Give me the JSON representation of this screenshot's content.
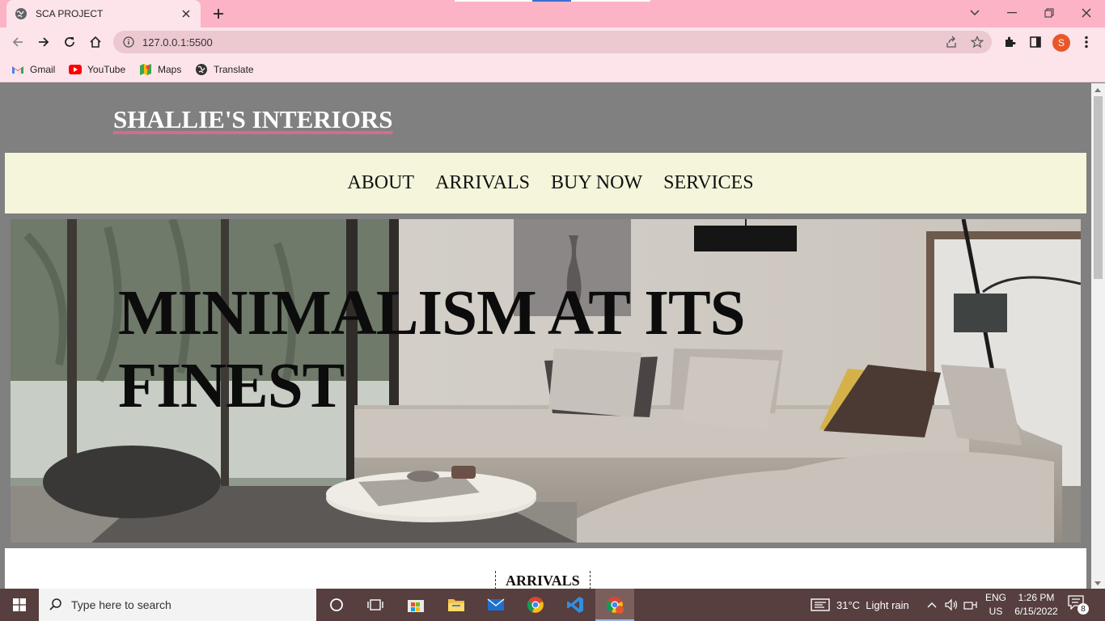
{
  "browser": {
    "tab_title": "SCA PROJECT",
    "url": "127.0.0.1:5500",
    "profile_initial": "S",
    "bookmarks": [
      "Gmail",
      "YouTube",
      "Maps",
      "Translate"
    ]
  },
  "page": {
    "brand": "SHALLIE'S INTERIORS",
    "nav": [
      "ABOUT",
      "ARRIVALS",
      "BUY NOW",
      "SERVICES"
    ],
    "hero_title": "MINIMALISM AT ITS FINEST",
    "section_title": "ARRIVALS",
    "colors": {
      "page_bg": "#808080",
      "nav_bg": "#f5f5dc",
      "brand_underline": "#d86b8c",
      "tab_strip": "#fbb3c5"
    }
  },
  "taskbar": {
    "search_placeholder": "Type here to search",
    "weather": "31°C  Light rain",
    "lang_line1": "ENG",
    "lang_line2": "US",
    "time": "1:26 PM",
    "date": "6/15/2022",
    "notification_count": "8",
    "pinned_icons": [
      "task-view-icon",
      "microsoft-store-icon",
      "file-explorer-icon",
      "mail-icon",
      "chrome-icon",
      "vscode-icon",
      "chrome-profile-icon"
    ]
  }
}
